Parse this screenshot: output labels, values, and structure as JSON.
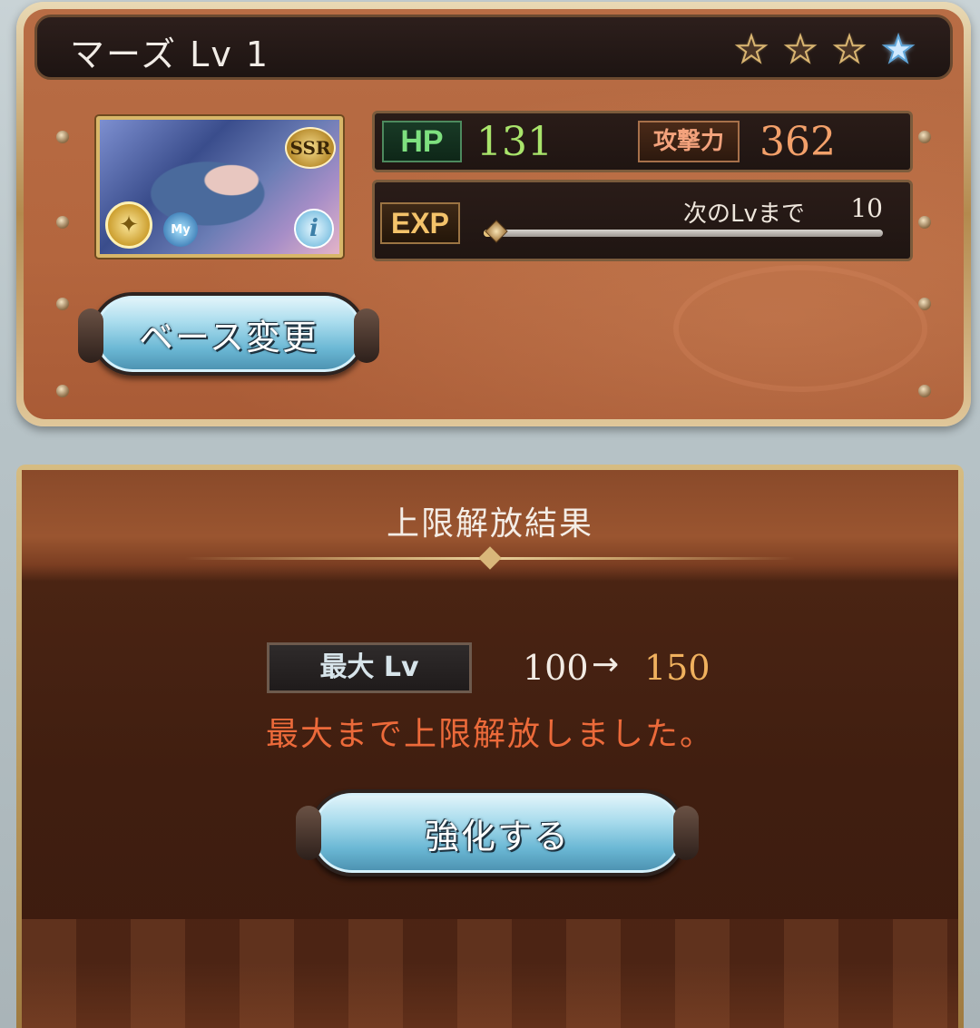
{
  "character": {
    "title": "マーズ Lv 1",
    "rarity_badge": "SSR",
    "my_badge": "My",
    "info_icon_glyph": "i",
    "element_icon": "wind-compass-icon",
    "stars": [
      {
        "type": "filled",
        "glyph": "★"
      },
      {
        "type": "filled",
        "glyph": "★"
      },
      {
        "type": "filled",
        "glyph": "★"
      },
      {
        "type": "blue",
        "glyph": "★"
      }
    ]
  },
  "stats": {
    "hp_label": "HP",
    "hp_value": "131",
    "atk_label": "攻撃力",
    "atk_value": "362",
    "exp_label": "EXP",
    "next_label": "次のLvまで",
    "next_value": "10",
    "exp_progress": 0.02
  },
  "buttons": {
    "base_change": "ベース変更",
    "enhance": "強化する"
  },
  "result": {
    "section_title": "上限解放結果",
    "max_lv_label": "最大 Lv",
    "lv_from": "100",
    "lv_arrow": "→",
    "lv_to": "150",
    "message": "最大まで上限解放しました。"
  },
  "colors": {
    "hp_value": "#a9e46b",
    "atk_value": "#f2a06a",
    "lv_to": "#f0b15e",
    "message": "#ec6a3a",
    "button": "#a9dced"
  }
}
